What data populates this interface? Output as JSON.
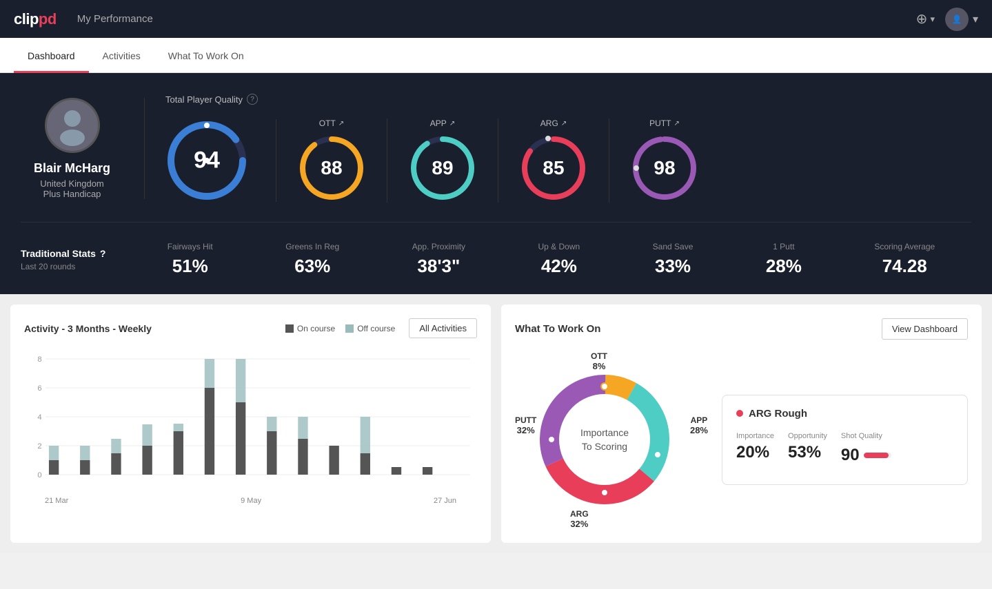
{
  "app": {
    "logo": "clippd",
    "nav_title": "My Performance",
    "add_label": "+",
    "chevron": "▾"
  },
  "tabs": [
    {
      "label": "Dashboard",
      "active": true
    },
    {
      "label": "Activities",
      "active": false
    },
    {
      "label": "What To Work On",
      "active": false
    }
  ],
  "player": {
    "name": "Blair McHarg",
    "country": "United Kingdom",
    "handicap": "Plus Handicap"
  },
  "total_quality": {
    "label": "Total Player Quality",
    "value": 94,
    "color": "#3a7fd5"
  },
  "metrics": [
    {
      "key": "OTT",
      "value": 88,
      "color": "#f5a623",
      "bg": "#2a2f3e"
    },
    {
      "key": "APP",
      "value": 89,
      "color": "#4ecdc4",
      "bg": "#2a2f3e"
    },
    {
      "key": "ARG",
      "value": 85,
      "color": "#e83e5a",
      "bg": "#2a2f3e"
    },
    {
      "key": "PUTT",
      "value": 98,
      "color": "#9b59b6",
      "bg": "#2a2f3e"
    }
  ],
  "traditional_stats": {
    "title": "Traditional Stats",
    "subtitle": "Last 20 rounds",
    "items": [
      {
        "name": "Fairways Hit",
        "value": "51%"
      },
      {
        "name": "Greens In Reg",
        "value": "63%"
      },
      {
        "name": "App. Proximity",
        "value": "38'3\""
      },
      {
        "name": "Up & Down",
        "value": "42%"
      },
      {
        "name": "Sand Save",
        "value": "33%"
      },
      {
        "name": "1 Putt",
        "value": "28%"
      },
      {
        "name": "Scoring Average",
        "value": "74.28"
      }
    ]
  },
  "activity_chart": {
    "title": "Activity - 3 Months - Weekly",
    "legend": [
      {
        "label": "On course",
        "color": "#555"
      },
      {
        "label": "Off course",
        "color": "#9bb"
      }
    ],
    "all_activities_btn": "All Activities",
    "x_labels": [
      "21 Mar",
      "9 May",
      "27 Jun"
    ],
    "bars": [
      {
        "on": 1,
        "off": 1
      },
      {
        "on": 1,
        "off": 1
      },
      {
        "on": 1.5,
        "off": 1
      },
      {
        "on": 2,
        "off": 1.5
      },
      {
        "on": 3,
        "off": 0.5
      },
      {
        "on": 6,
        "off": 2.5
      },
      {
        "on": 5,
        "off": 3.5
      },
      {
        "on": 3,
        "off": 1
      },
      {
        "on": 2.5,
        "off": 1.5
      },
      {
        "on": 2,
        "off": 0
      },
      {
        "on": 1.5,
        "off": 2.5
      },
      {
        "on": 0.5,
        "off": 0
      },
      {
        "on": 0.5,
        "off": 0
      }
    ],
    "y_labels": [
      "0",
      "2",
      "4",
      "6",
      "8"
    ]
  },
  "what_to_work_on": {
    "title": "What To Work On",
    "view_dashboard_btn": "View Dashboard",
    "donut_center": "Importance\nTo Scoring",
    "segments": [
      {
        "label": "OTT",
        "pct": "8%",
        "color": "#f5a623"
      },
      {
        "label": "APP",
        "pct": "28%",
        "color": "#4ecdc4"
      },
      {
        "label": "ARG",
        "pct": "32%",
        "color": "#e83e5a"
      },
      {
        "label": "PUTT",
        "pct": "32%",
        "color": "#9b59b6"
      }
    ],
    "card": {
      "title": "ARG Rough",
      "dot_color": "#e83e5a",
      "importance": "20%",
      "opportunity": "53%",
      "shot_quality": "90",
      "importance_label": "Importance",
      "opportunity_label": "Opportunity",
      "shot_quality_label": "Shot Quality"
    }
  }
}
